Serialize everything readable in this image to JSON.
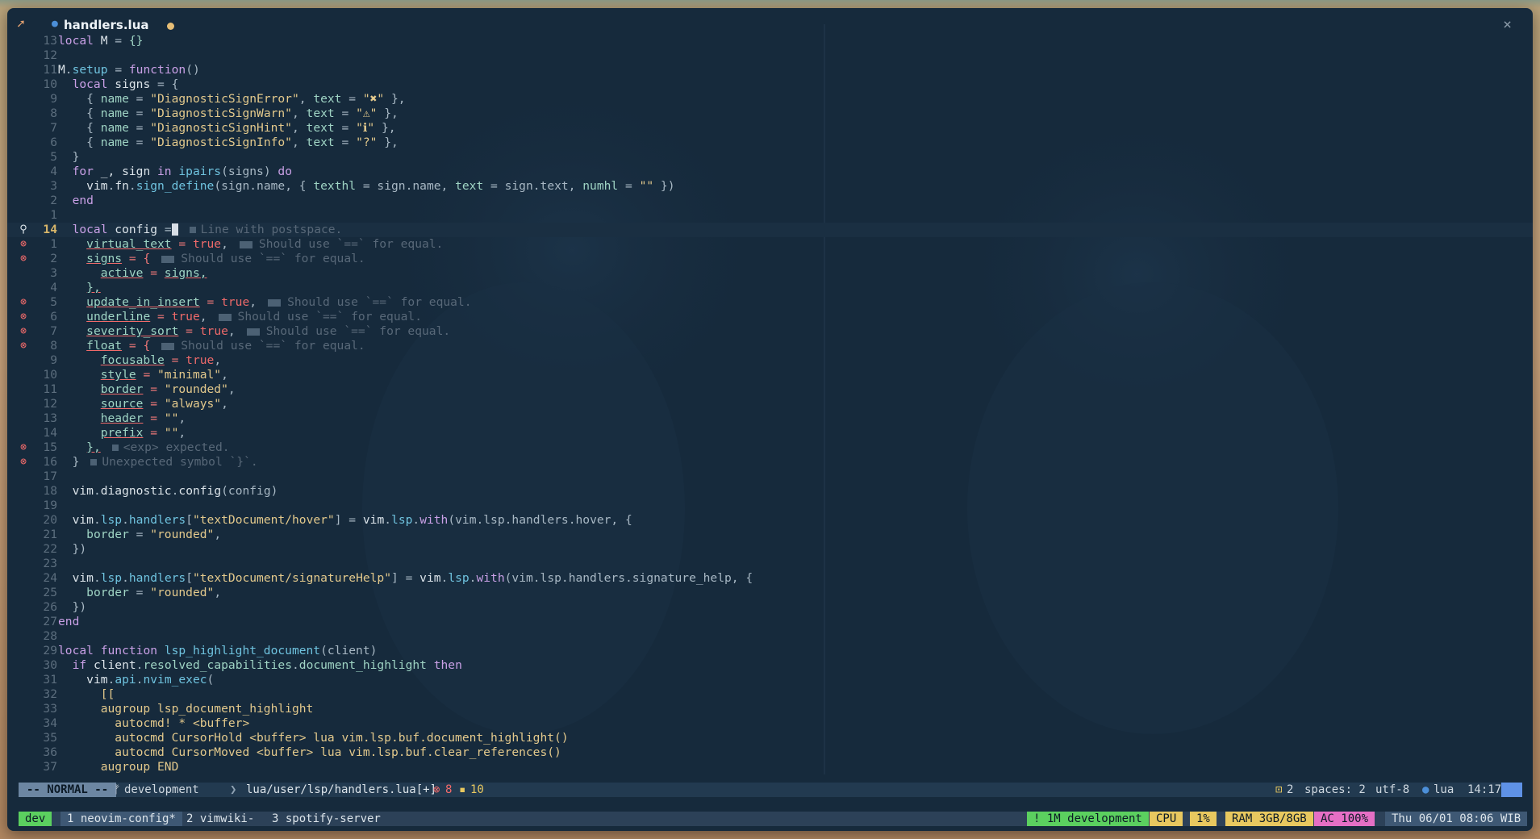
{
  "colors": {
    "bg": "#162a3c",
    "accent_green": "#5bd05f",
    "accent_yellow": "#e8c85f",
    "accent_pink": "#e56fc5",
    "normal_mode": "#6c86a2"
  },
  "tab": {
    "icon": "rocket-icon",
    "filetype_icon": "lua-icon",
    "filename": "handlers.lua",
    "close_glyph": "×"
  },
  "lines": [
    {
      "n": "13",
      "code": [
        [
          "k",
          "local"
        ],
        [
          "v",
          " M "
        ],
        [
          "p",
          "= "
        ],
        [
          "fld",
          "{}"
        ]
      ]
    },
    {
      "n": "12",
      "code": []
    },
    {
      "n": "11",
      "code": [
        [
          "v",
          "M"
        ],
        [
          "p",
          "."
        ],
        [
          "f",
          "setup"
        ],
        [
          "p",
          " = "
        ],
        [
          "k",
          "function"
        ],
        [
          "p",
          "()"
        ]
      ]
    },
    {
      "n": "10",
      "code": [
        [
          "p",
          "  "
        ],
        [
          "k",
          "local"
        ],
        [
          "v",
          " signs "
        ],
        [
          "p",
          "= {"
        ]
      ]
    },
    {
      "n": "9",
      "code": [
        [
          "p",
          "    { "
        ],
        [
          "fld",
          "name"
        ],
        [
          "p",
          " = "
        ],
        [
          "s",
          "\"DiagnosticSignError\""
        ],
        [
          "p",
          ", "
        ],
        [
          "fld",
          "text"
        ],
        [
          "p",
          " = "
        ],
        [
          "s",
          "\"✖\""
        ],
        [
          "p",
          " },"
        ]
      ]
    },
    {
      "n": "8",
      "code": [
        [
          "p",
          "    { "
        ],
        [
          "fld",
          "name"
        ],
        [
          "p",
          " = "
        ],
        [
          "s",
          "\"DiagnosticSignWarn\""
        ],
        [
          "p",
          ", "
        ],
        [
          "fld",
          "text"
        ],
        [
          "p",
          " = "
        ],
        [
          "s",
          "\"⚠\""
        ],
        [
          "p",
          " },"
        ]
      ]
    },
    {
      "n": "7",
      "code": [
        [
          "p",
          "    { "
        ],
        [
          "fld",
          "name"
        ],
        [
          "p",
          " = "
        ],
        [
          "s",
          "\"DiagnosticSignHint\""
        ],
        [
          "p",
          ", "
        ],
        [
          "fld",
          "text"
        ],
        [
          "p",
          " = "
        ],
        [
          "s",
          "\"ℹ\""
        ],
        [
          "p",
          " },"
        ]
      ]
    },
    {
      "n": "6",
      "code": [
        [
          "p",
          "    { "
        ],
        [
          "fld",
          "name"
        ],
        [
          "p",
          " = "
        ],
        [
          "s",
          "\"DiagnosticSignInfo\""
        ],
        [
          "p",
          ", "
        ],
        [
          "fld",
          "text"
        ],
        [
          "p",
          " = "
        ],
        [
          "s",
          "\"?\""
        ],
        [
          "p",
          " },"
        ]
      ]
    },
    {
      "n": "5",
      "code": [
        [
          "p",
          "  }"
        ]
      ]
    },
    {
      "n": "4",
      "code": [
        [
          "p",
          "  "
        ],
        [
          "k",
          "for"
        ],
        [
          "v",
          " _, sign "
        ],
        [
          "k",
          "in"
        ],
        [
          "f",
          " ipairs"
        ],
        [
          "p",
          "(signs) "
        ],
        [
          "k",
          "do"
        ]
      ]
    },
    {
      "n": "3",
      "code": [
        [
          "p",
          "    "
        ],
        [
          "v",
          "vim"
        ],
        [
          "p",
          "."
        ],
        [
          "v",
          "fn"
        ],
        [
          "p",
          "."
        ],
        [
          "f",
          "sign_define"
        ],
        [
          "p",
          "(sign.name, { "
        ],
        [
          "fld",
          "texthl"
        ],
        [
          "p",
          " = sign.name, "
        ],
        [
          "fld",
          "text"
        ],
        [
          "p",
          " = sign.text, "
        ],
        [
          "fld",
          "numhl"
        ],
        [
          "p",
          " = "
        ],
        [
          "s",
          "\"\""
        ],
        [
          "p",
          " })"
        ]
      ]
    },
    {
      "n": "2",
      "code": [
        [
          "p",
          "  "
        ],
        [
          "k",
          "end"
        ]
      ]
    },
    {
      "n": "1",
      "code": []
    },
    {
      "n": "14",
      "cur": true,
      "sign": "lightbulb-icon",
      "code": [
        [
          "p",
          "  "
        ],
        [
          "k",
          "local"
        ],
        [
          "v",
          " config "
        ],
        [
          "p",
          "="
        ]
      ],
      "cursor": true,
      "vt": "Line with postspace.",
      "vtsmall": true
    },
    {
      "n": "1",
      "sign": "error-icon",
      "code": [
        [
          "p",
          "    "
        ],
        [
          "u",
          "virtual_text"
        ],
        [
          "eq",
          " = "
        ],
        [
          "bool",
          "true"
        ],
        [
          "p",
          ","
        ]
      ],
      "vt": "Should use `==` for equal."
    },
    {
      "n": "2",
      "sign": "error-icon",
      "code": [
        [
          "p",
          "    "
        ],
        [
          "u",
          "signs"
        ],
        [
          "eq",
          " = {"
        ]
      ],
      "vt": "Should use `==` for equal."
    },
    {
      "n": "3",
      "code": [
        [
          "p",
          "      "
        ],
        [
          "u",
          "active"
        ],
        [
          "eq",
          " = "
        ],
        [
          "u",
          "signs,"
        ]
      ]
    },
    {
      "n": "4",
      "code": [
        [
          "p",
          "    "
        ],
        [
          "u",
          "},"
        ]
      ]
    },
    {
      "n": "5",
      "sign": "error-icon",
      "code": [
        [
          "p",
          "    "
        ],
        [
          "u",
          "update_in_insert"
        ],
        [
          "eq",
          " = "
        ],
        [
          "bool",
          "true"
        ],
        [
          "p",
          ","
        ]
      ],
      "vt": "Should use `==` for equal."
    },
    {
      "n": "6",
      "sign": "error-icon",
      "code": [
        [
          "p",
          "    "
        ],
        [
          "u",
          "underline"
        ],
        [
          "eq",
          " = "
        ],
        [
          "bool",
          "true"
        ],
        [
          "p",
          ","
        ]
      ],
      "vt": "Should use `==` for equal."
    },
    {
      "n": "7",
      "sign": "error-icon",
      "code": [
        [
          "p",
          "    "
        ],
        [
          "u",
          "severity_sort"
        ],
        [
          "eq",
          " = "
        ],
        [
          "bool",
          "true"
        ],
        [
          "p",
          ","
        ]
      ],
      "vt": "Should use `==` for equal."
    },
    {
      "n": "8",
      "sign": "error-icon",
      "code": [
        [
          "p",
          "    "
        ],
        [
          "u",
          "float"
        ],
        [
          "eq",
          " = {"
        ]
      ],
      "vt": "Should use `==` for equal."
    },
    {
      "n": "9",
      "code": [
        [
          "p",
          "      "
        ],
        [
          "u",
          "focusable"
        ],
        [
          "eq",
          " = "
        ],
        [
          "bool",
          "true"
        ],
        [
          "p",
          ","
        ]
      ]
    },
    {
      "n": "10",
      "code": [
        [
          "p",
          "      "
        ],
        [
          "u",
          "style"
        ],
        [
          "eq",
          " = "
        ],
        [
          "s",
          "\"minimal\""
        ],
        [
          "p",
          ","
        ]
      ]
    },
    {
      "n": "11",
      "code": [
        [
          "p",
          "      "
        ],
        [
          "u",
          "border"
        ],
        [
          "eq",
          " = "
        ],
        [
          "s",
          "\"rounded\""
        ],
        [
          "p",
          ","
        ]
      ]
    },
    {
      "n": "12",
      "code": [
        [
          "p",
          "      "
        ],
        [
          "u",
          "source"
        ],
        [
          "eq",
          " = "
        ],
        [
          "s",
          "\"always\""
        ],
        [
          "p",
          ","
        ]
      ]
    },
    {
      "n": "13",
      "code": [
        [
          "p",
          "      "
        ],
        [
          "u",
          "header"
        ],
        [
          "eq",
          " = "
        ],
        [
          "s",
          "\"\""
        ],
        [
          "p",
          ","
        ]
      ]
    },
    {
      "n": "14",
      "code": [
        [
          "p",
          "      "
        ],
        [
          "u",
          "prefix"
        ],
        [
          "eq",
          " = "
        ],
        [
          "s",
          "\"\""
        ],
        [
          "p",
          ","
        ]
      ]
    },
    {
      "n": "15",
      "sign": "error-icon",
      "code": [
        [
          "p",
          "    "
        ],
        [
          "u",
          "},"
        ]
      ],
      "vt": "<exp> expected.",
      "vtsmall": true
    },
    {
      "n": "16",
      "sign": "error-icon",
      "code": [
        [
          "p",
          "  }"
        ]
      ],
      "vt": "Unexpected symbol `}`.",
      "vtsmall": true
    },
    {
      "n": "17",
      "code": []
    },
    {
      "n": "18",
      "code": [
        [
          "p",
          "  "
        ],
        [
          "v",
          "vim"
        ],
        [
          "p",
          "."
        ],
        [
          "v",
          "diagnostic"
        ],
        [
          "p",
          "."
        ],
        [
          "v",
          "config"
        ],
        [
          "p",
          "(config)"
        ]
      ]
    },
    {
      "n": "19",
      "code": []
    },
    {
      "n": "20",
      "code": [
        [
          "p",
          "  "
        ],
        [
          "v",
          "vim"
        ],
        [
          "p",
          "."
        ],
        [
          "f",
          "lsp"
        ],
        [
          "p",
          "."
        ],
        [
          "f",
          "handlers"
        ],
        [
          "p",
          "["
        ],
        [
          "s",
          "\"textDocument/hover\""
        ],
        [
          "p",
          "] = "
        ],
        [
          "v",
          "vim"
        ],
        [
          "p",
          "."
        ],
        [
          "f",
          "lsp"
        ],
        [
          "p",
          "."
        ],
        [
          "k",
          "with"
        ],
        [
          "p",
          "(vim.lsp.handlers.hover, {"
        ]
      ]
    },
    {
      "n": "21",
      "code": [
        [
          "p",
          "    "
        ],
        [
          "fld",
          "border"
        ],
        [
          "p",
          " = "
        ],
        [
          "s",
          "\"rounded\""
        ],
        [
          "p",
          ","
        ]
      ]
    },
    {
      "n": "22",
      "code": [
        [
          "p",
          "  })"
        ]
      ]
    },
    {
      "n": "23",
      "code": []
    },
    {
      "n": "24",
      "code": [
        [
          "p",
          "  "
        ],
        [
          "v",
          "vim"
        ],
        [
          "p",
          "."
        ],
        [
          "f",
          "lsp"
        ],
        [
          "p",
          "."
        ],
        [
          "f",
          "handlers"
        ],
        [
          "p",
          "["
        ],
        [
          "s",
          "\"textDocument/signatureHelp\""
        ],
        [
          "p",
          "] = "
        ],
        [
          "v",
          "vim"
        ],
        [
          "p",
          "."
        ],
        [
          "f",
          "lsp"
        ],
        [
          "p",
          "."
        ],
        [
          "k",
          "with"
        ],
        [
          "p",
          "(vim.lsp.handlers.signature_help, {"
        ]
      ]
    },
    {
      "n": "25",
      "code": [
        [
          "p",
          "    "
        ],
        [
          "fld",
          "border"
        ],
        [
          "p",
          " = "
        ],
        [
          "s",
          "\"rounded\""
        ],
        [
          "p",
          ","
        ]
      ]
    },
    {
      "n": "26",
      "code": [
        [
          "p",
          "  })"
        ]
      ]
    },
    {
      "n": "27",
      "code": [
        [
          "k",
          "end"
        ]
      ]
    },
    {
      "n": "28",
      "code": []
    },
    {
      "n": "29",
      "code": [
        [
          "k",
          "local"
        ],
        [
          "k",
          " function"
        ],
        [
          "f",
          " lsp_highlight_document"
        ],
        [
          "p",
          "(client)"
        ]
      ]
    },
    {
      "n": "30",
      "code": [
        [
          "p",
          "  "
        ],
        [
          "k",
          "if"
        ],
        [
          "v",
          " client"
        ],
        [
          "p",
          "."
        ],
        [
          "fld",
          "resolved_capabilities"
        ],
        [
          "p",
          "."
        ],
        [
          "fld",
          "document_highlight"
        ],
        [
          "k",
          " then"
        ]
      ]
    },
    {
      "n": "31",
      "code": [
        [
          "p",
          "    "
        ],
        [
          "v",
          "vim"
        ],
        [
          "p",
          "."
        ],
        [
          "f",
          "api"
        ],
        [
          "p",
          "."
        ],
        [
          "f",
          "nvim_exec"
        ],
        [
          "p",
          "("
        ]
      ]
    },
    {
      "n": "32",
      "code": [
        [
          "p",
          "      "
        ],
        [
          "s",
          "[["
        ]
      ]
    },
    {
      "n": "33",
      "code": [
        [
          "p",
          "      "
        ],
        [
          "s",
          "augroup lsp_document_highlight"
        ]
      ]
    },
    {
      "n": "34",
      "code": [
        [
          "p",
          "        "
        ],
        [
          "s",
          "autocmd! * <buffer>"
        ]
      ]
    },
    {
      "n": "35",
      "code": [
        [
          "p",
          "        "
        ],
        [
          "s",
          "autocmd CursorHold <buffer> lua vim.lsp.buf.document_highlight()"
        ]
      ]
    },
    {
      "n": "36",
      "code": [
        [
          "p",
          "        "
        ],
        [
          "s",
          "autocmd CursorMoved <buffer> lua vim.lsp.buf.clear_references()"
        ]
      ]
    },
    {
      "n": "37",
      "code": [
        [
          "p",
          "      "
        ],
        [
          "s",
          "augroup END"
        ]
      ]
    }
  ],
  "status": {
    "mode": "-- NORMAL --",
    "branch_icon": "git-branch-icon",
    "branch": "development",
    "path": "lua/user/lsp/handlers.lua[+]",
    "errors": "8",
    "warnings": "10",
    "buffers": "2",
    "spaces": "spaces: 2",
    "encoding": "utf-8",
    "filetype": "lua",
    "position": "14:17"
  },
  "tmux": {
    "session": "dev",
    "windows": [
      {
        "label": "1 neovim-config*"
      },
      {
        "label": "2 vimwiki-"
      },
      {
        "label": "3 spotify-server"
      }
    ],
    "git_alert": "! 1M development",
    "cpu_label": "CPU",
    "cpu_value": "1%",
    "ram": "RAM 3GB/8GB",
    "ac": "AC 100%",
    "datetime": "Thu 06/01 08:06 WIB"
  }
}
